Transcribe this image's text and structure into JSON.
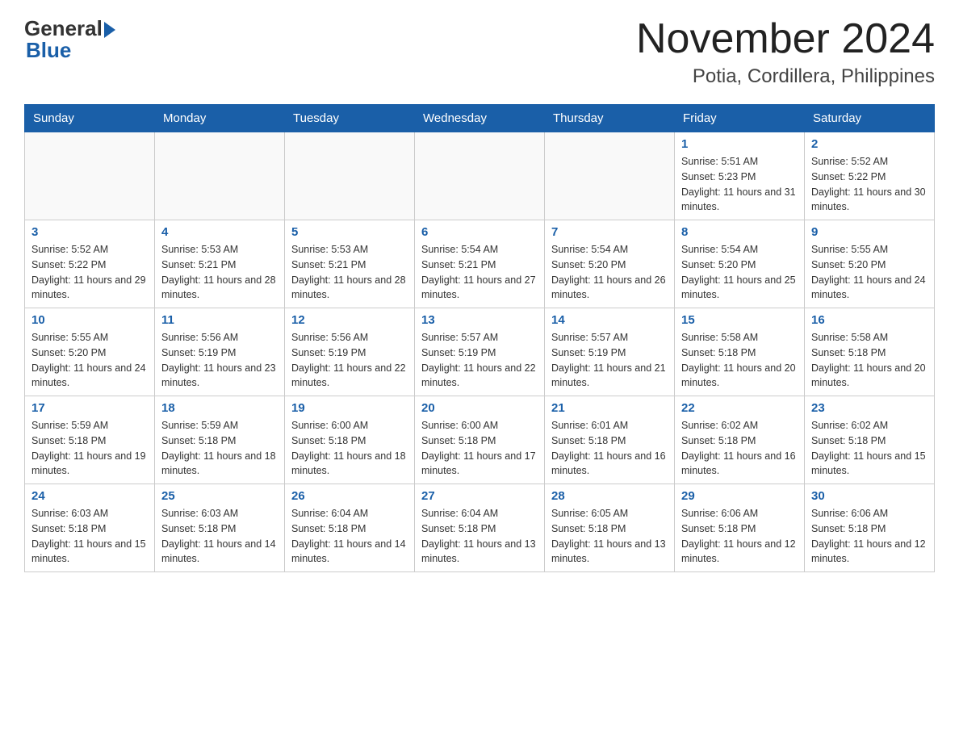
{
  "logo": {
    "general": "General",
    "blue": "Blue"
  },
  "title": "November 2024",
  "subtitle": "Potia, Cordillera, Philippines",
  "days_of_week": [
    "Sunday",
    "Monday",
    "Tuesday",
    "Wednesday",
    "Thursday",
    "Friday",
    "Saturday"
  ],
  "weeks": [
    [
      {
        "day": "",
        "sunrise": "",
        "sunset": "",
        "daylight": ""
      },
      {
        "day": "",
        "sunrise": "",
        "sunset": "",
        "daylight": ""
      },
      {
        "day": "",
        "sunrise": "",
        "sunset": "",
        "daylight": ""
      },
      {
        "day": "",
        "sunrise": "",
        "sunset": "",
        "daylight": ""
      },
      {
        "day": "",
        "sunrise": "",
        "sunset": "",
        "daylight": ""
      },
      {
        "day": "1",
        "sunrise": "Sunrise: 5:51 AM",
        "sunset": "Sunset: 5:23 PM",
        "daylight": "Daylight: 11 hours and 31 minutes."
      },
      {
        "day": "2",
        "sunrise": "Sunrise: 5:52 AM",
        "sunset": "Sunset: 5:22 PM",
        "daylight": "Daylight: 11 hours and 30 minutes."
      }
    ],
    [
      {
        "day": "3",
        "sunrise": "Sunrise: 5:52 AM",
        "sunset": "Sunset: 5:22 PM",
        "daylight": "Daylight: 11 hours and 29 minutes."
      },
      {
        "day": "4",
        "sunrise": "Sunrise: 5:53 AM",
        "sunset": "Sunset: 5:21 PM",
        "daylight": "Daylight: 11 hours and 28 minutes."
      },
      {
        "day": "5",
        "sunrise": "Sunrise: 5:53 AM",
        "sunset": "Sunset: 5:21 PM",
        "daylight": "Daylight: 11 hours and 28 minutes."
      },
      {
        "day": "6",
        "sunrise": "Sunrise: 5:54 AM",
        "sunset": "Sunset: 5:21 PM",
        "daylight": "Daylight: 11 hours and 27 minutes."
      },
      {
        "day": "7",
        "sunrise": "Sunrise: 5:54 AM",
        "sunset": "Sunset: 5:20 PM",
        "daylight": "Daylight: 11 hours and 26 minutes."
      },
      {
        "day": "8",
        "sunrise": "Sunrise: 5:54 AM",
        "sunset": "Sunset: 5:20 PM",
        "daylight": "Daylight: 11 hours and 25 minutes."
      },
      {
        "day": "9",
        "sunrise": "Sunrise: 5:55 AM",
        "sunset": "Sunset: 5:20 PM",
        "daylight": "Daylight: 11 hours and 24 minutes."
      }
    ],
    [
      {
        "day": "10",
        "sunrise": "Sunrise: 5:55 AM",
        "sunset": "Sunset: 5:20 PM",
        "daylight": "Daylight: 11 hours and 24 minutes."
      },
      {
        "day": "11",
        "sunrise": "Sunrise: 5:56 AM",
        "sunset": "Sunset: 5:19 PM",
        "daylight": "Daylight: 11 hours and 23 minutes."
      },
      {
        "day": "12",
        "sunrise": "Sunrise: 5:56 AM",
        "sunset": "Sunset: 5:19 PM",
        "daylight": "Daylight: 11 hours and 22 minutes."
      },
      {
        "day": "13",
        "sunrise": "Sunrise: 5:57 AM",
        "sunset": "Sunset: 5:19 PM",
        "daylight": "Daylight: 11 hours and 22 minutes."
      },
      {
        "day": "14",
        "sunrise": "Sunrise: 5:57 AM",
        "sunset": "Sunset: 5:19 PM",
        "daylight": "Daylight: 11 hours and 21 minutes."
      },
      {
        "day": "15",
        "sunrise": "Sunrise: 5:58 AM",
        "sunset": "Sunset: 5:18 PM",
        "daylight": "Daylight: 11 hours and 20 minutes."
      },
      {
        "day": "16",
        "sunrise": "Sunrise: 5:58 AM",
        "sunset": "Sunset: 5:18 PM",
        "daylight": "Daylight: 11 hours and 20 minutes."
      }
    ],
    [
      {
        "day": "17",
        "sunrise": "Sunrise: 5:59 AM",
        "sunset": "Sunset: 5:18 PM",
        "daylight": "Daylight: 11 hours and 19 minutes."
      },
      {
        "day": "18",
        "sunrise": "Sunrise: 5:59 AM",
        "sunset": "Sunset: 5:18 PM",
        "daylight": "Daylight: 11 hours and 18 minutes."
      },
      {
        "day": "19",
        "sunrise": "Sunrise: 6:00 AM",
        "sunset": "Sunset: 5:18 PM",
        "daylight": "Daylight: 11 hours and 18 minutes."
      },
      {
        "day": "20",
        "sunrise": "Sunrise: 6:00 AM",
        "sunset": "Sunset: 5:18 PM",
        "daylight": "Daylight: 11 hours and 17 minutes."
      },
      {
        "day": "21",
        "sunrise": "Sunrise: 6:01 AM",
        "sunset": "Sunset: 5:18 PM",
        "daylight": "Daylight: 11 hours and 16 minutes."
      },
      {
        "day": "22",
        "sunrise": "Sunrise: 6:02 AM",
        "sunset": "Sunset: 5:18 PM",
        "daylight": "Daylight: 11 hours and 16 minutes."
      },
      {
        "day": "23",
        "sunrise": "Sunrise: 6:02 AM",
        "sunset": "Sunset: 5:18 PM",
        "daylight": "Daylight: 11 hours and 15 minutes."
      }
    ],
    [
      {
        "day": "24",
        "sunrise": "Sunrise: 6:03 AM",
        "sunset": "Sunset: 5:18 PM",
        "daylight": "Daylight: 11 hours and 15 minutes."
      },
      {
        "day": "25",
        "sunrise": "Sunrise: 6:03 AM",
        "sunset": "Sunset: 5:18 PM",
        "daylight": "Daylight: 11 hours and 14 minutes."
      },
      {
        "day": "26",
        "sunrise": "Sunrise: 6:04 AM",
        "sunset": "Sunset: 5:18 PM",
        "daylight": "Daylight: 11 hours and 14 minutes."
      },
      {
        "day": "27",
        "sunrise": "Sunrise: 6:04 AM",
        "sunset": "Sunset: 5:18 PM",
        "daylight": "Daylight: 11 hours and 13 minutes."
      },
      {
        "day": "28",
        "sunrise": "Sunrise: 6:05 AM",
        "sunset": "Sunset: 5:18 PM",
        "daylight": "Daylight: 11 hours and 13 minutes."
      },
      {
        "day": "29",
        "sunrise": "Sunrise: 6:06 AM",
        "sunset": "Sunset: 5:18 PM",
        "daylight": "Daylight: 11 hours and 12 minutes."
      },
      {
        "day": "30",
        "sunrise": "Sunrise: 6:06 AM",
        "sunset": "Sunset: 5:18 PM",
        "daylight": "Daylight: 11 hours and 12 minutes."
      }
    ]
  ]
}
